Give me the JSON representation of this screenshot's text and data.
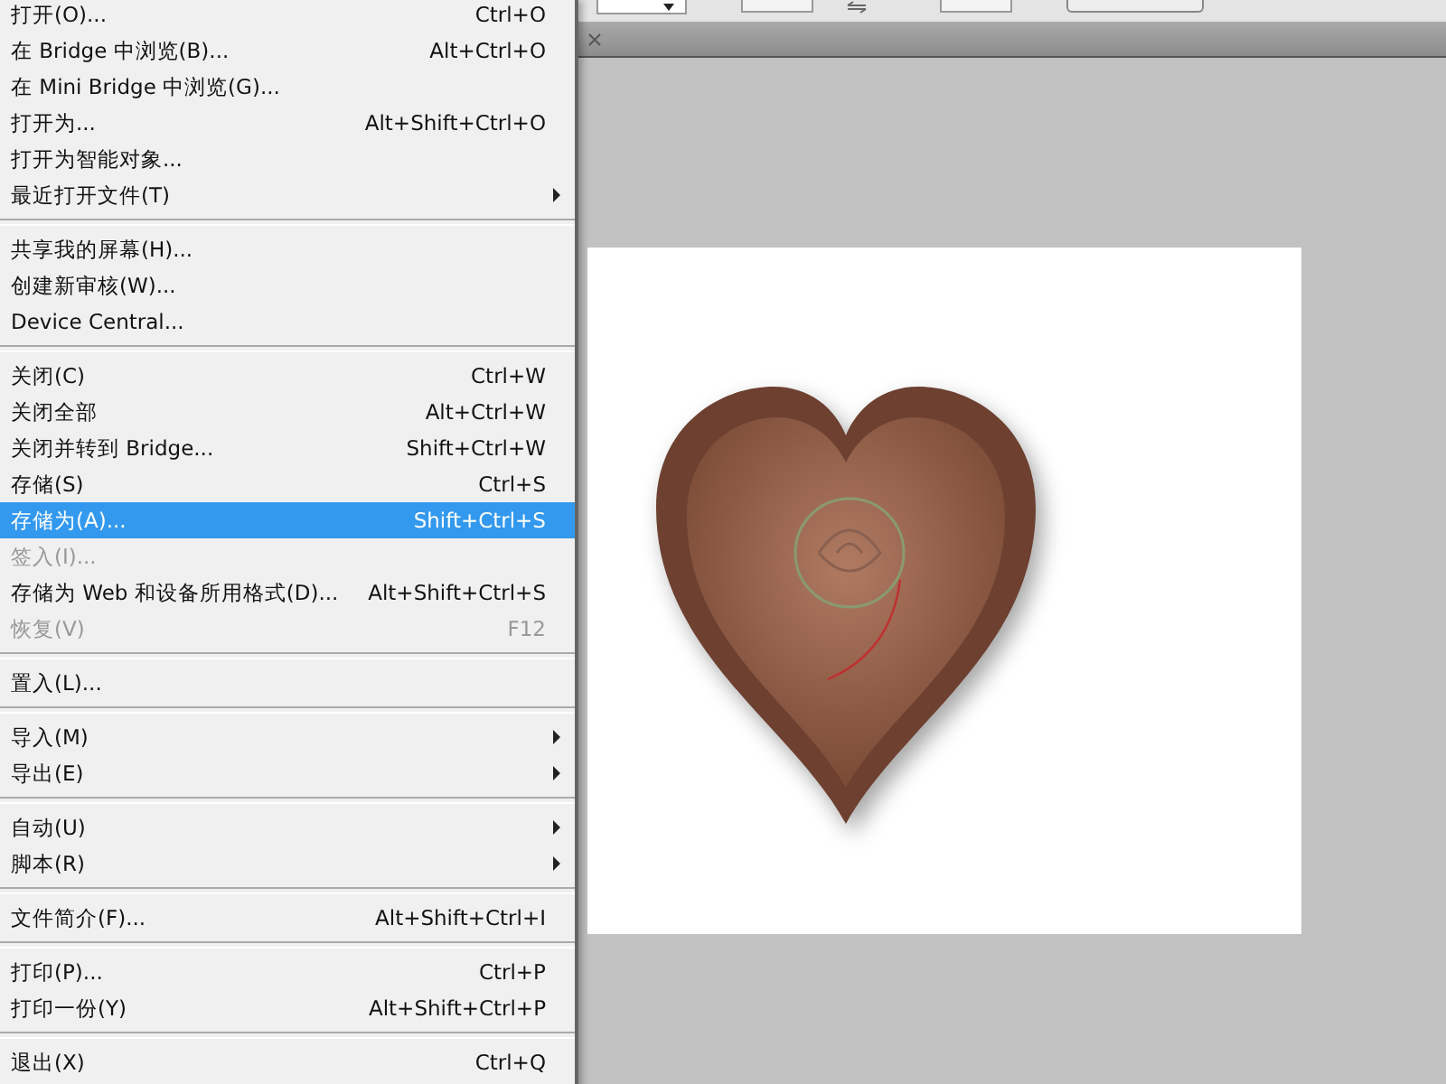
{
  "menu": {
    "groups": [
      [
        {
          "label": "打开(O)...",
          "shortcut": "Ctrl+O",
          "submenu": false,
          "disabled": false,
          "selected": false
        },
        {
          "label": "在 Bridge 中浏览(B)...",
          "shortcut": "Alt+Ctrl+O",
          "submenu": false,
          "disabled": false,
          "selected": false
        },
        {
          "label": "在 Mini Bridge 中浏览(G)...",
          "submenu": false,
          "disabled": false,
          "selected": false
        },
        {
          "label": "打开为...",
          "shortcut": "Alt+Shift+Ctrl+O",
          "submenu": false,
          "disabled": false,
          "selected": false
        },
        {
          "label": "打开为智能对象...",
          "submenu": false,
          "disabled": false,
          "selected": false
        },
        {
          "label": "最近打开文件(T)",
          "submenu": true,
          "disabled": false,
          "selected": false
        }
      ],
      [
        {
          "label": "共享我的屏幕(H)...",
          "submenu": false,
          "disabled": false,
          "selected": false
        },
        {
          "label": "创建新审核(W)...",
          "submenu": false,
          "disabled": false,
          "selected": false
        },
        {
          "label": "Device Central...",
          "submenu": false,
          "disabled": false,
          "selected": false
        }
      ],
      [
        {
          "label": "关闭(C)",
          "shortcut": "Ctrl+W",
          "submenu": false,
          "disabled": false,
          "selected": false
        },
        {
          "label": "关闭全部",
          "shortcut": "Alt+Ctrl+W",
          "submenu": false,
          "disabled": false,
          "selected": false
        },
        {
          "label": "关闭并转到 Bridge...",
          "shortcut": "Shift+Ctrl+W",
          "submenu": false,
          "disabled": false,
          "selected": false
        },
        {
          "label": "存储(S)",
          "shortcut": "Ctrl+S",
          "submenu": false,
          "disabled": false,
          "selected": false
        },
        {
          "label": "存储为(A)...",
          "shortcut": "Shift+Ctrl+S",
          "submenu": false,
          "disabled": false,
          "selected": true
        },
        {
          "label": "签入(I)...",
          "submenu": false,
          "disabled": true,
          "selected": false
        },
        {
          "label": "存储为 Web 和设备所用格式(D)...",
          "shortcut": "Alt+Shift+Ctrl+S",
          "submenu": false,
          "disabled": false,
          "selected": false
        },
        {
          "label": "恢复(V)",
          "shortcut": "F12",
          "submenu": false,
          "disabled": true,
          "selected": false
        }
      ],
      [
        {
          "label": "置入(L)...",
          "submenu": false,
          "disabled": false,
          "selected": false
        }
      ],
      [
        {
          "label": "导入(M)",
          "submenu": true,
          "disabled": false,
          "selected": false
        },
        {
          "label": "导出(E)",
          "submenu": true,
          "disabled": false,
          "selected": false
        }
      ],
      [
        {
          "label": "自动(U)",
          "submenu": true,
          "disabled": false,
          "selected": false
        },
        {
          "label": "脚本(R)",
          "submenu": true,
          "disabled": false,
          "selected": false
        }
      ],
      [
        {
          "label": "文件简介(F)...",
          "shortcut": "Alt+Shift+Ctrl+I",
          "submenu": false,
          "disabled": false,
          "selected": false
        }
      ],
      [
        {
          "label": "打印(P)...",
          "shortcut": "Ctrl+P",
          "submenu": false,
          "disabled": false,
          "selected": false
        },
        {
          "label": "打印一份(Y)",
          "shortcut": "Alt+Shift+Ctrl+P",
          "submenu": false,
          "disabled": false,
          "selected": false
        }
      ],
      [
        {
          "label": "退出(X)",
          "shortcut": "Ctrl+Q",
          "submenu": false,
          "disabled": false,
          "selected": false
        }
      ]
    ]
  }
}
